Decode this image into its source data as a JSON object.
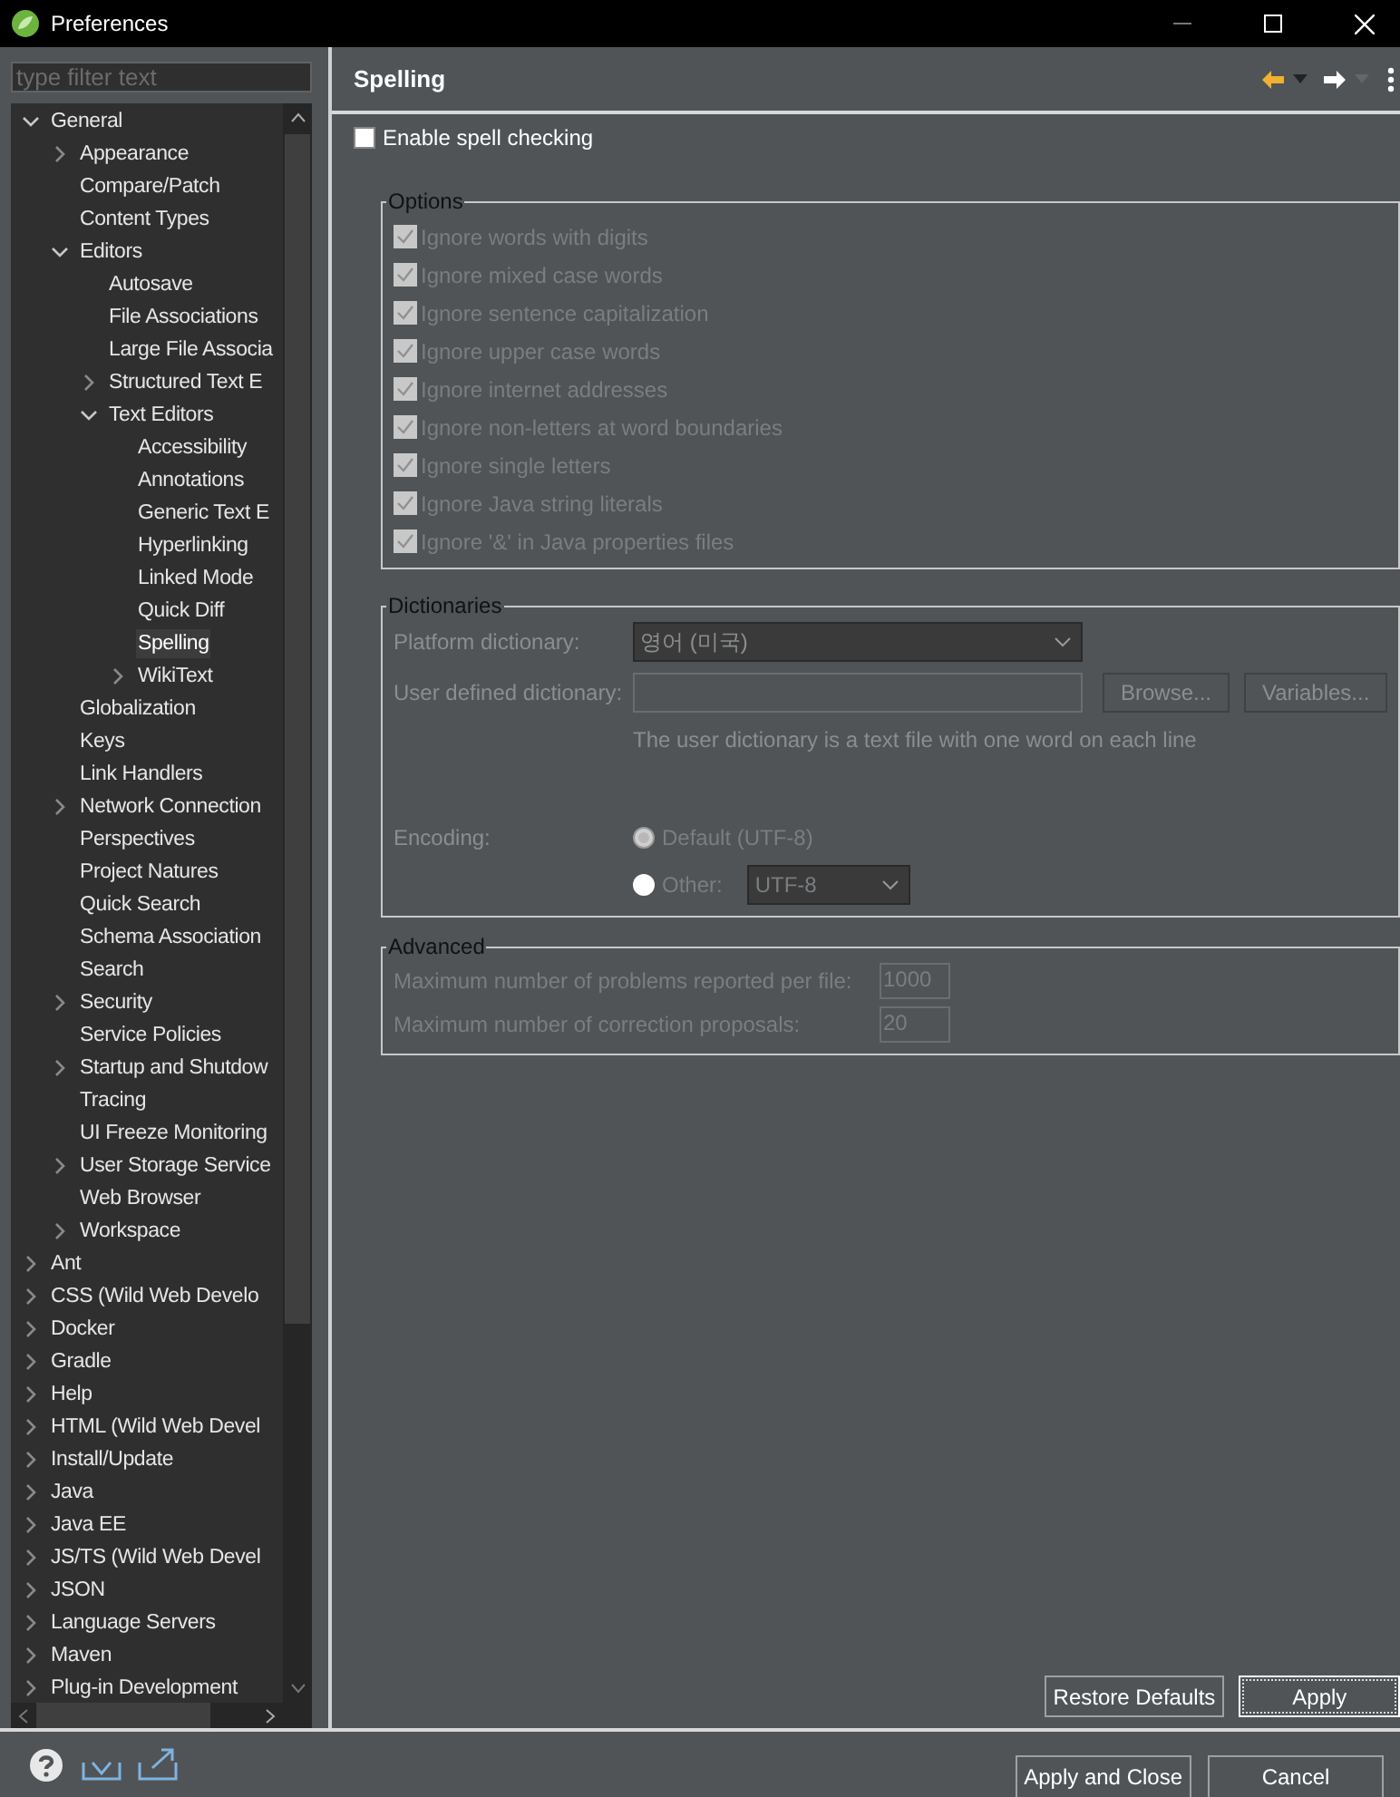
{
  "window": {
    "title": "Preferences"
  },
  "filter": {
    "placeholder": "type filter text"
  },
  "tree": [
    {
      "label": "General",
      "expanded": true,
      "selected": false,
      "children": [
        {
          "label": "Appearance",
          "expanded": false,
          "selected": false
        },
        {
          "label": "Compare/Patch",
          "selected": false
        },
        {
          "label": "Content Types",
          "selected": false
        },
        {
          "label": "Editors",
          "expanded": true,
          "selected": false,
          "children": [
            {
              "label": "Autosave",
              "selected": false
            },
            {
              "label": "File Associations",
              "selected": false
            },
            {
              "label": "Large File Associa",
              "selected": false
            },
            {
              "label": "Structured Text E",
              "expanded": false,
              "selected": false
            },
            {
              "label": "Text Editors",
              "expanded": true,
              "selected": false,
              "children": [
                {
                  "label": "Accessibility",
                  "selected": false
                },
                {
                  "label": "Annotations",
                  "selected": false
                },
                {
                  "label": "Generic Text E",
                  "selected": false
                },
                {
                  "label": "Hyperlinking",
                  "selected": false
                },
                {
                  "label": "Linked Mode",
                  "selected": false
                },
                {
                  "label": "Quick Diff",
                  "selected": false
                },
                {
                  "label": "Spelling",
                  "selected": true
                },
                {
                  "label": "WikiText",
                  "expanded": false,
                  "selected": false
                }
              ]
            }
          ]
        },
        {
          "label": "Globalization",
          "selected": false
        },
        {
          "label": "Keys",
          "selected": false
        },
        {
          "label": "Link Handlers",
          "selected": false
        },
        {
          "label": "Network Connection",
          "expanded": false,
          "selected": false
        },
        {
          "label": "Perspectives",
          "selected": false
        },
        {
          "label": "Project Natures",
          "selected": false
        },
        {
          "label": "Quick Search",
          "selected": false
        },
        {
          "label": "Schema Association",
          "selected": false
        },
        {
          "label": "Search",
          "selected": false
        },
        {
          "label": "Security",
          "expanded": false,
          "selected": false
        },
        {
          "label": "Service Policies",
          "selected": false
        },
        {
          "label": "Startup and Shutdow",
          "expanded": false,
          "selected": false
        },
        {
          "label": "Tracing",
          "selected": false
        },
        {
          "label": "UI Freeze Monitoring",
          "selected": false
        },
        {
          "label": "User Storage Service",
          "expanded": false,
          "selected": false
        },
        {
          "label": "Web Browser",
          "selected": false
        },
        {
          "label": "Workspace",
          "expanded": false,
          "selected": false
        }
      ]
    },
    {
      "label": "Ant",
      "expanded": false,
      "selected": false
    },
    {
      "label": "CSS (Wild Web Develo",
      "expanded": false,
      "selected": false
    },
    {
      "label": "Docker",
      "expanded": false,
      "selected": false
    },
    {
      "label": "Gradle",
      "expanded": false,
      "selected": false
    },
    {
      "label": "Help",
      "expanded": false,
      "selected": false
    },
    {
      "label": "HTML (Wild Web Devel",
      "expanded": false,
      "selected": false
    },
    {
      "label": "Install/Update",
      "expanded": false,
      "selected": false
    },
    {
      "label": "Java",
      "expanded": false,
      "selected": false
    },
    {
      "label": "Java EE",
      "expanded": false,
      "selected": false
    },
    {
      "label": "JS/TS (Wild Web Devel",
      "expanded": false,
      "selected": false
    },
    {
      "label": "JSON",
      "expanded": false,
      "selected": false
    },
    {
      "label": "Language Servers",
      "expanded": false,
      "selected": false
    },
    {
      "label": "Maven",
      "expanded": false,
      "selected": false
    },
    {
      "label": "Plug-in Development",
      "expanded": false,
      "selected": false
    }
  ],
  "page": {
    "title": "Spelling",
    "enable": {
      "label": "Enable spell checking",
      "checked": false
    },
    "options": {
      "title": "Options",
      "items": [
        {
          "label": "Ignore words with digits",
          "checked": true,
          "disabled": true
        },
        {
          "label": "Ignore mixed case words",
          "checked": true,
          "disabled": true
        },
        {
          "label": "Ignore sentence capitalization",
          "checked": true,
          "disabled": true
        },
        {
          "label": "Ignore upper case words",
          "checked": true,
          "disabled": true
        },
        {
          "label": "Ignore internet addresses",
          "checked": true,
          "disabled": true
        },
        {
          "label": "Ignore non-letters at word boundaries",
          "checked": true,
          "disabled": true
        },
        {
          "label": "Ignore single letters",
          "checked": true,
          "disabled": true
        },
        {
          "label": "Ignore Java string literals",
          "checked": true,
          "disabled": true
        },
        {
          "label": "Ignore '&' in Java properties files",
          "checked": true,
          "disabled": true
        }
      ]
    },
    "dictionaries": {
      "title": "Dictionaries",
      "platform": {
        "label": "Platform dictionary:",
        "value": "영어 (미국)"
      },
      "user": {
        "label": "User defined dictionary:"
      },
      "buttons": [
        "Browse...",
        "Variables..."
      ],
      "hint": "The user dictionary is a text file with one word on each line",
      "encoding": {
        "label": "Encoding:",
        "options": [
          {
            "label": "Default (UTF-8)",
            "selected": true
          },
          {
            "label": "Other:",
            "selected": false
          }
        ],
        "other_value": "UTF-8"
      }
    },
    "advanced": {
      "title": "Advanced",
      "fields": [
        {
          "label": "Maximum number of problems reported per file:",
          "value": "1000"
        },
        {
          "label": "Maximum number of correction proposals:",
          "value": "20"
        }
      ]
    },
    "buttons": [
      {
        "label": "Restore Defaults",
        "default": false
      },
      {
        "label": "Apply",
        "default": true
      }
    ]
  },
  "footer_buttons": [
    "Apply and Close",
    "Cancel"
  ]
}
